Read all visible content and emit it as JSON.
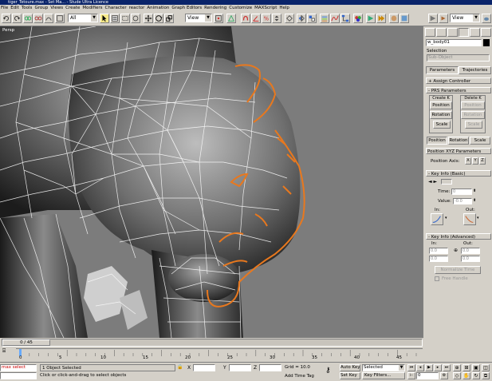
{
  "window": {
    "title": "tiger_Tetoure.max - Set Ma... - Stude Ultra Licence"
  },
  "menu": [
    "File",
    "Edit",
    "Tools",
    "Group",
    "Views",
    "Create",
    "Modifiers",
    "Character",
    "reactor",
    "Animation",
    "Graph Editors",
    "Rendering",
    "Customize",
    "MAXScript",
    "Help"
  ],
  "toolbar": {
    "filter_value": "All",
    "refcoord_value": "View",
    "refcoord2_value": "View"
  },
  "viewport": {
    "label": "Persp",
    "frame_counter": "0 / 45",
    "accent": "#e8781e",
    "bg": "#7c7c7c"
  },
  "panel": {
    "object_name": "w_body01",
    "selection_label": "Selection",
    "selection_value": "Sub-Object",
    "tab_parameters": "Parameters",
    "tab_trajectories": "Trajectories",
    "assign_controller": "Assign Controller",
    "prs_title": "PRS Parameters",
    "create_key_label": "Create K",
    "delete_key_label": "Delete K",
    "position": "Position",
    "rotation": "Rotation",
    "scale": "Scale",
    "position_tab": "Position",
    "rotation_tab": "Rotation",
    "scale_tab": "Scale",
    "pos_xyz_title": "Position XYZ Parameters",
    "pos_axis_label": "Position Axis:",
    "axis_x": "X",
    "axis_y": "Y",
    "axis_z": "Z",
    "key_info_basic": "Key Info (Basic)",
    "time_label": "Time:",
    "time_value": "0",
    "value_label": "Value:",
    "value_value": "-0.0",
    "in_label": "In:",
    "out_label": "Out:",
    "key_info_adv": "Key Info (Advanced)",
    "adv_in": "In:",
    "adv_out": "Out:",
    "adv_v1": "0.0",
    "adv_v2": "0.0",
    "adv_v3": "0.0",
    "adv_v4": "0.0",
    "normalize_time": "Normalize Time",
    "free_handle": "Free Handle"
  },
  "timeline": {
    "ticks": [
      "0",
      "5",
      "10",
      "15",
      "20",
      "25",
      "30",
      "35",
      "40",
      "45"
    ]
  },
  "status": {
    "maxscript": "max select",
    "selected_text": "1 Object Selected",
    "prompt": "Click or click-and-drag to select objects",
    "x_label": "X",
    "y_label": "Y",
    "z_label": "Z",
    "grid": "Grid = 10.0",
    "add_time_tag": "Add Time Tag",
    "auto_key": "Auto Key",
    "selected_dropdown": "Selected",
    "set_key": "Set Key",
    "key_filters": "Key Filters...",
    "frame_field": "0"
  }
}
